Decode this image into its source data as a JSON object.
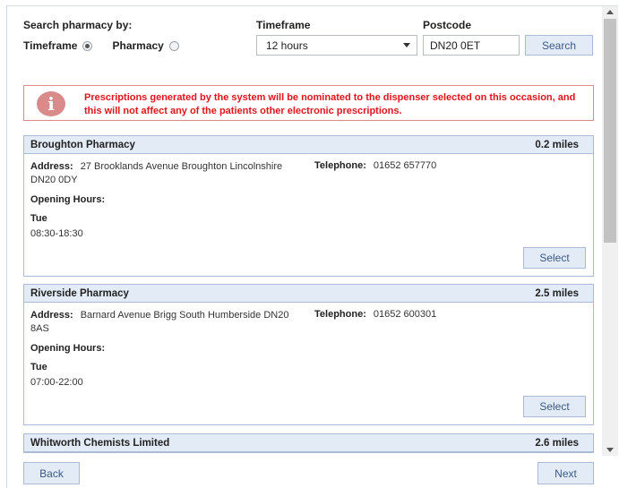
{
  "search": {
    "search_by_label": "Search pharmacy by:",
    "timeframe_label": "Timeframe",
    "postcode_label": "Postcode",
    "radio_timeframe": "Timeframe",
    "radio_pharmacy": "Pharmacy",
    "timeframe_value": "12 hours",
    "postcode_value": "DN20 0ET",
    "search_button": "Search"
  },
  "warning": {
    "text": "Prescriptions generated by the system will be nominated to the dispenser selected on this occasion, and this will not affect any of the patients other electronic prescriptions."
  },
  "labels": {
    "address": "Address:",
    "telephone": "Telephone:",
    "opening_hours": "Opening Hours:",
    "select": "Select"
  },
  "pharmacies": [
    {
      "name": "Broughton Pharmacy",
      "distance": "0.2 miles",
      "address": "27 Brooklands Avenue Broughton Lincolnshire DN20 0DY",
      "telephone": "01652 657770",
      "day": "Tue",
      "hours": "08:30-18:30"
    },
    {
      "name": "Riverside Pharmacy",
      "distance": "2.5 miles",
      "address": "Barnard Avenue Brigg South Humberside DN20 8AS",
      "telephone": "01652 600301",
      "day": "Tue",
      "hours": "07:00-22:00"
    },
    {
      "name": "Whitworth Chemists Limited",
      "distance": "2.6 miles"
    }
  ],
  "footer": {
    "back": "Back",
    "next": "Next"
  },
  "colors": {
    "accent_fill": "#e3ebf7",
    "accent_border": "#a9bbd6",
    "warning_text": "#e0141e",
    "warning_border": "#e08a8a"
  }
}
